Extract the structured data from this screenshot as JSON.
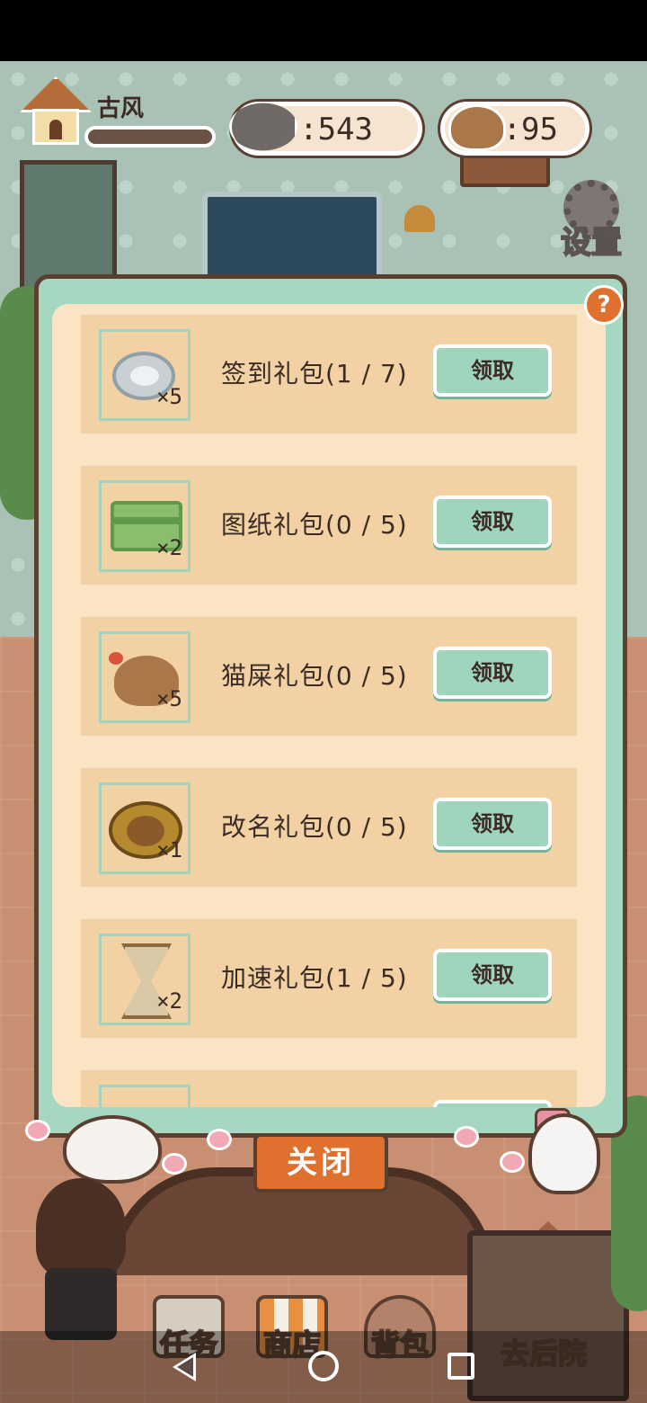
{
  "hud": {
    "player_name": "古风",
    "exp_progress": 0.0,
    "fish_count": ":543",
    "poop_count": ":95",
    "settings_label": "设置"
  },
  "panel": {
    "help_symbol": "?",
    "rows": [
      {
        "icon": "cat-food-can-icon",
        "qty": "×5",
        "title": "签到礼包(1 / 7)",
        "button": "领取"
      },
      {
        "icon": "blueprint-card-icon",
        "qty": "×2",
        "title": "图纸礼包(0 / 5)",
        "button": "领取"
      },
      {
        "icon": "cat-poop-icon",
        "qty": "×5",
        "title": "猫屎礼包(0 / 5)",
        "button": "领取"
      },
      {
        "icon": "rename-mirror-icon",
        "qty": "×1",
        "title": "改名礼包(0 / 5)",
        "button": "领取"
      },
      {
        "icon": "hourglass-icon",
        "qty": "×2",
        "title": "加速礼包(1 / 5)",
        "button": "领取"
      }
    ]
  },
  "close_label": "关闭",
  "tabs": {
    "task": "任务",
    "shop": "商店",
    "bag": "背包",
    "backyard": "去后院"
  },
  "colors": {
    "panel_green": "#a6d8c1",
    "panel_cream": "#fbe4c3",
    "row_tan": "#f2d2a4",
    "claim_button": "#9fd5bd",
    "close_button": "#e0702e",
    "help_orange": "#e0702e",
    "outline_brown": "#5a3f31"
  }
}
